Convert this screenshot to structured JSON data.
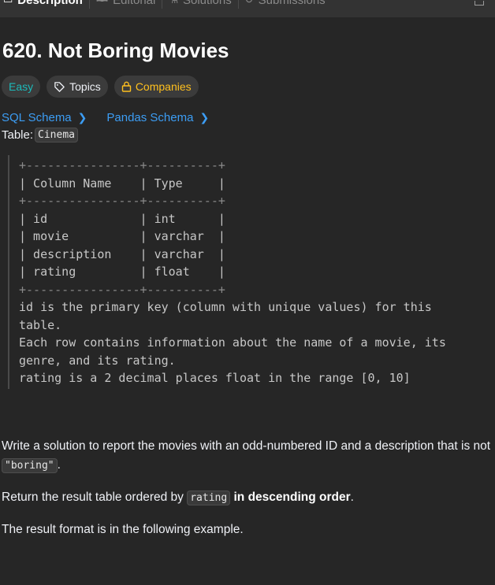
{
  "tabs": [
    {
      "label": "Description",
      "icon": "▭",
      "active": true
    },
    {
      "label": "Editorial",
      "icon": "🕮",
      "active": false
    },
    {
      "label": "Solutions",
      "icon": "⚗",
      "active": false
    },
    {
      "label": "Submissions",
      "icon": "↺",
      "active": false
    }
  ],
  "problem": {
    "title": "620. Not Boring Movies",
    "difficulty": "Easy",
    "topics_label": "Topics",
    "companies_label": "Companies"
  },
  "schema_links": {
    "sql": "SQL Schema",
    "pandas": "Pandas Schema"
  },
  "table_label": "Table:",
  "table_name": "Cinema",
  "schema_block": {
    "border1": "+----------------+----------+",
    "header": "| Column Name    | Type     |",
    "border2": "+----------------+----------+",
    "row1": "| id             | int      |",
    "row2": "| movie          | varchar  |",
    "row3": "| description    | varchar  |",
    "row4": "| rating         | float    |",
    "border3": "+----------------+----------+",
    "note1": "id is the primary key (column with unique values) for this",
    "note2": "table.",
    "note3": "Each row contains information about the name of a movie, its",
    "note4": "genre, and its rating.",
    "note5": "rating is a 2 decimal places float in the range [0, 10]"
  },
  "description": {
    "p1_text": "Write a solution to report the movies with an odd-numbered ID and a description that is not ",
    "p1_code": "\"boring\"",
    "p1_end": ".",
    "p2_text": "Return the result table ordered by ",
    "p2_code": "rating",
    "p2_bold": "in descending order",
    "p2_end": ".",
    "p3_text": "The result format is in the following example."
  },
  "colors": {
    "background": "#262626",
    "easy": "#1cbaba",
    "companies": "#ffc01e",
    "link": "#3c9df4"
  }
}
